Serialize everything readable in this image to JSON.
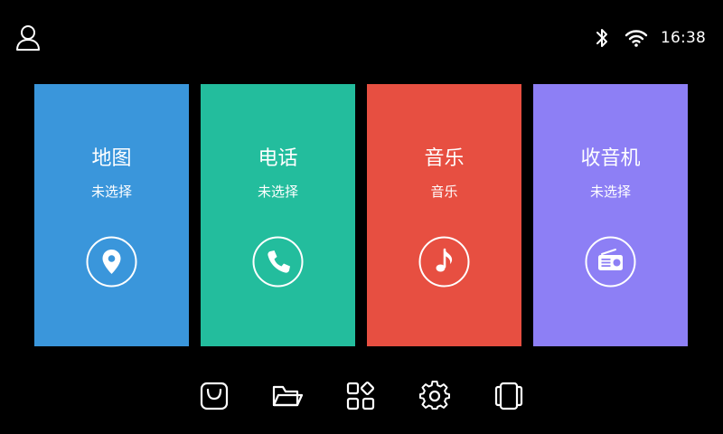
{
  "status_bar": {
    "time": "16:38",
    "icons": [
      "user-icon",
      "bluetooth-icon",
      "wifi-icon"
    ]
  },
  "tiles": [
    {
      "title": "地图",
      "subtitle": "未选择",
      "icon": "location-pin-icon",
      "color": "#3a96db"
    },
    {
      "title": "电话",
      "subtitle": "未选择",
      "icon": "phone-icon",
      "color": "#23bd9d"
    },
    {
      "title": "音乐",
      "subtitle": "音乐",
      "icon": "music-note-icon",
      "color": "#e74f41"
    },
    {
      "title": "收音机",
      "subtitle": "未选择",
      "icon": "radio-icon",
      "color": "#8d7ff5"
    }
  ],
  "dock": {
    "icons": [
      "store-bag-icon",
      "folder-icon",
      "apps-grid-icon",
      "settings-gear-icon",
      "multitask-icon"
    ]
  }
}
